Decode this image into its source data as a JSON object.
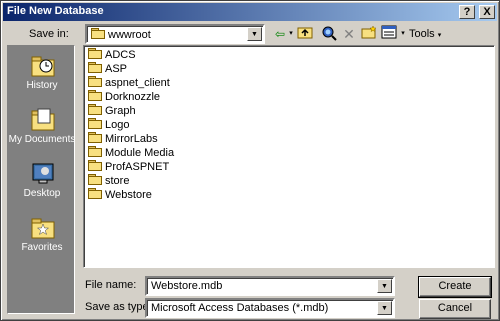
{
  "window": {
    "title": "File New Database",
    "help_button": "?",
    "close_button": "X"
  },
  "toolbar": {
    "save_in_label": "Save in:",
    "save_in_value": "wwwroot",
    "tools_label": "Tools"
  },
  "places": [
    {
      "label": "History",
      "icon": "history-icon"
    },
    {
      "label": "My Documents",
      "icon": "my-documents-icon"
    },
    {
      "label": "Desktop",
      "icon": "desktop-icon"
    },
    {
      "label": "Favorites",
      "icon": "favorites-icon"
    }
  ],
  "folders": [
    "ADCS",
    "ASP",
    "aspnet_client",
    "Dorknozzle",
    "Graph",
    "Logo",
    "MirrorLabs",
    "Module Media",
    "ProfASPNET",
    "store",
    "Webstore"
  ],
  "form": {
    "file_name_label": "File name:",
    "file_name_value": "Webstore.mdb",
    "save_type_label": "Save as type:",
    "save_type_value": "Microsoft Access Databases (*.mdb)"
  },
  "buttons": {
    "create": "Create",
    "cancel": "Cancel"
  }
}
